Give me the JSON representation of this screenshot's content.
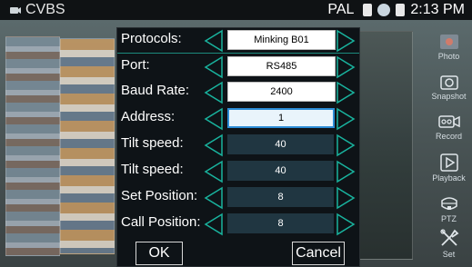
{
  "topbar": {
    "title": "CVBS",
    "signal": "PAL",
    "time": "2:13 PM",
    "icons": [
      "camera-icon",
      "memory-icon",
      "network-icon",
      "battery-icon"
    ]
  },
  "dialog": {
    "rows": [
      {
        "label": "Protocols:",
        "value": "Minking B01"
      },
      {
        "label": "Port:",
        "value": "RS485"
      },
      {
        "label": "Baud Rate:",
        "value": "2400"
      },
      {
        "label": "Address:",
        "value": "1"
      },
      {
        "label": "Tilt speed:",
        "value": "40"
      },
      {
        "label": "Tilt speed:",
        "value": "40"
      },
      {
        "label": "Set Position:",
        "value": "8"
      },
      {
        "label": "Call Position:",
        "value": "8"
      }
    ],
    "ok_label": "OK",
    "cancel_label": "Cancel"
  },
  "sidebar": {
    "items": [
      {
        "label": "Photo",
        "icon": "photo-icon"
      },
      {
        "label": "Snapshot",
        "icon": "snapshot-icon"
      },
      {
        "label": "Record",
        "icon": "record-icon"
      },
      {
        "label": "Playback",
        "icon": "playback-icon"
      },
      {
        "label": "PTZ",
        "icon": "ptz-icon"
      },
      {
        "label": "Set",
        "icon": "settings-icon"
      }
    ]
  },
  "colors": {
    "arrow_outline": "#19b39e",
    "focus_border": "#2c8cd6",
    "field_bg": "#203641"
  }
}
